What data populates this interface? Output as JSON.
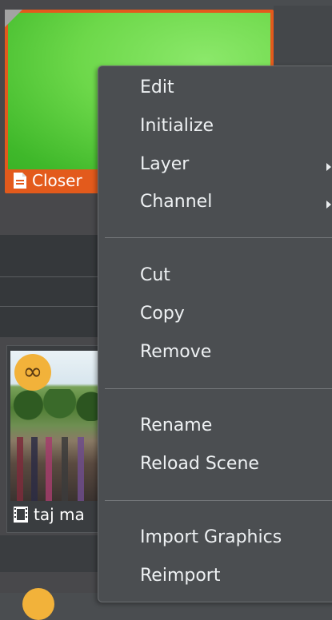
{
  "tiles": [
    {
      "label": "Closer"
    },
    {
      "label": "taj ma"
    }
  ],
  "icons": {
    "loop": "∞"
  },
  "context_menu": {
    "group1": [
      "Edit",
      "Initialize",
      "Layer",
      "Channel"
    ],
    "group2": [
      "Cut",
      "Copy",
      "Remove"
    ],
    "group3": [
      "Rename",
      "Reload Scene"
    ],
    "group4": [
      "Import Graphics",
      "Reimport"
    ]
  },
  "colors": {
    "tile_border": "#e35a1c",
    "tile_green": "#6dd84a",
    "badge": "#f2b23a",
    "menu_bg": "#4b4e51"
  }
}
